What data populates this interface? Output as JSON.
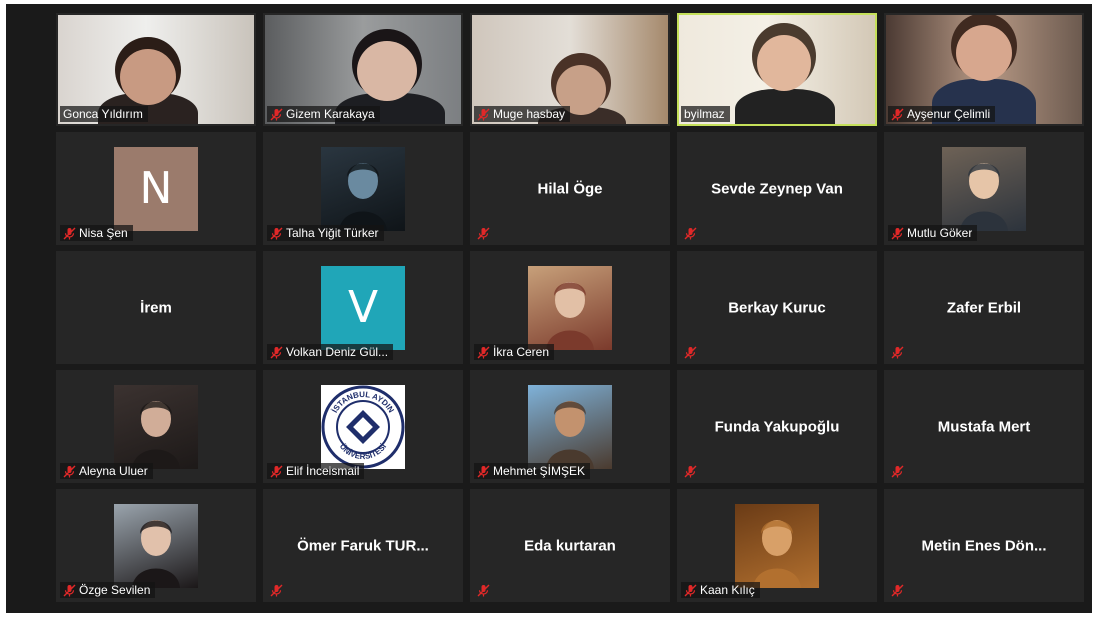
{
  "colors": {
    "background": "#1a1a1a",
    "tile": "#262626",
    "active_speaker_border": "#c5e05a",
    "mute_icon": "#e02828",
    "label_text": "#ffffff"
  },
  "participants": [
    {
      "name": "Gonca Yıldırım",
      "muted": false,
      "video": true,
      "active": false
    },
    {
      "name": "Gizem Karakaya",
      "muted": true,
      "video": true,
      "active": false
    },
    {
      "name": "Muge hasbay",
      "muted": true,
      "video": true,
      "active": false
    },
    {
      "name": "byilmaz",
      "muted": false,
      "video": true,
      "active": true
    },
    {
      "name": "Ayşenur Çelimli",
      "muted": true,
      "video": true,
      "active": false
    },
    {
      "name": "Nisa Şen",
      "muted": true,
      "avatar_letter": "N",
      "avatar_color": "#9b7b6c"
    },
    {
      "name": "Talha Yiğit Türker",
      "muted": true,
      "avatar_icon": "profile-photo-icon"
    },
    {
      "name": "",
      "center_name": "Hilal Öge",
      "muted": true
    },
    {
      "name": "",
      "center_name": "Sevde Zeynep Van",
      "muted": true
    },
    {
      "name": "Mutlu Göker",
      "muted": true,
      "avatar_icon": "profile-photo-icon"
    },
    {
      "name": "",
      "center_name": "İrem",
      "muted": false
    },
    {
      "name": "Volkan Deniz Gül...",
      "muted": true,
      "avatar_letter": "V",
      "avatar_color": "#20a6b8"
    },
    {
      "name": "İkra Ceren",
      "muted": true,
      "avatar_icon": "profile-photo-icon"
    },
    {
      "name": "",
      "center_name": "Berkay Kuruc",
      "muted": true
    },
    {
      "name": "",
      "center_name": "Zafer Erbil",
      "muted": true
    },
    {
      "name": "Aleyna Uluer",
      "muted": true,
      "avatar_icon": "profile-photo-icon"
    },
    {
      "name": "Elif İnceismail",
      "muted": true,
      "avatar_icon": "university-logo-icon"
    },
    {
      "name": "Mehmet ŞİMŞEK",
      "muted": true,
      "avatar_icon": "profile-photo-icon"
    },
    {
      "name": "",
      "center_name": "Funda Yakupoğlu",
      "muted": true
    },
    {
      "name": "",
      "center_name": "Mustafa Mert",
      "muted": true
    },
    {
      "name": "Özge Sevilen",
      "muted": true,
      "avatar_icon": "profile-photo-icon"
    },
    {
      "name": "",
      "center_name": "Ömer Faruk TUR...",
      "muted": true
    },
    {
      "name": "",
      "center_name": "Eda kurtaran",
      "muted": true
    },
    {
      "name": "Kaan Kılıç",
      "muted": true,
      "avatar_icon": "profile-photo-icon"
    },
    {
      "name": "",
      "center_name": "Metin Enes Dön...",
      "muted": true
    }
  ],
  "logo_text": {
    "top": "İSTANBUL AYDIN",
    "bottom": "ÜNİVERSİTESİ"
  }
}
